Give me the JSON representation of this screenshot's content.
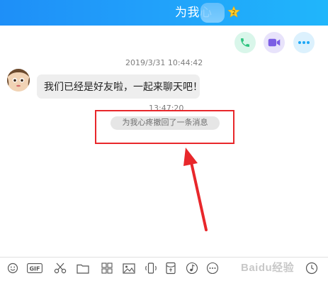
{
  "header": {
    "title": "为我心",
    "badge_text": "2"
  },
  "actions": {
    "call": "phone-icon",
    "video": "video-icon",
    "more": "more-icon"
  },
  "chat": {
    "timestamp_1": "2019/3/31 10:44:42",
    "message_1": "我们已经是好友啦，一起来聊天吧！",
    "timestamp_2": "13:47:20",
    "recall_notice": "为我心疼撤回了一条消息"
  },
  "toolbar": {
    "gif_label": "GIF",
    "watermark": "Baidu经验"
  },
  "colors": {
    "header_start": "#1e8ff8",
    "header_end": "#20b6fb",
    "call_icon": "#2fc480",
    "video_icon": "#7b5de4",
    "more_icon": "#1da7f5",
    "annotation_red": "#e8272b"
  }
}
